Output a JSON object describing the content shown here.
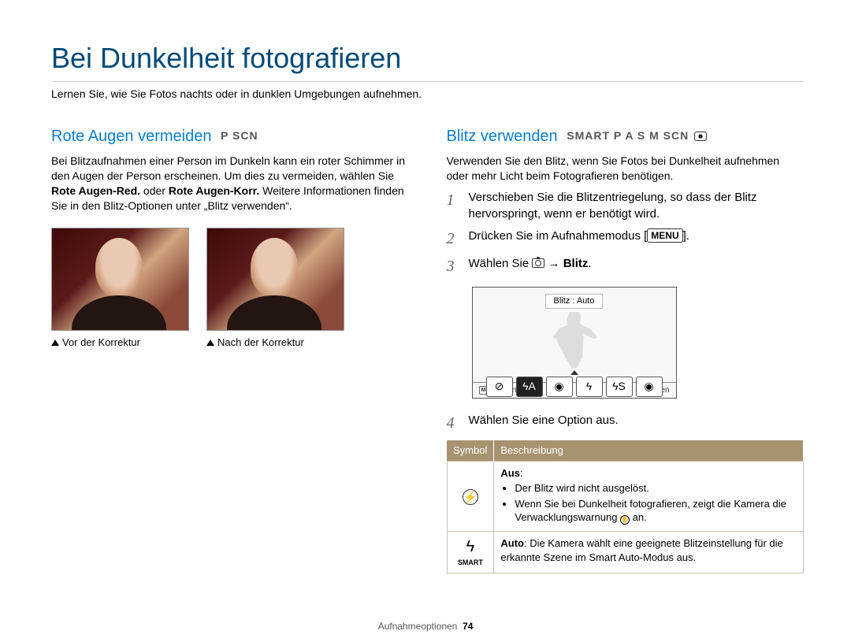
{
  "page": {
    "title": "Bei Dunkelheit fotografieren",
    "intro": "Lernen Sie, wie Sie Fotos nachts oder in dunklen Umgebungen aufnehmen.",
    "footer_section": "Aufnahmeoptionen",
    "footer_page": "74"
  },
  "left": {
    "heading": "Rote Augen vermeiden",
    "mode_icons": "P SCN",
    "body1": "Bei Blitzaufnahmen einer Person im Dunkeln kann ein roter Schimmer in den Augen der Person erscheinen. Um dies zu vermeiden, wählen Sie ",
    "bold1": "Rote Augen-Red.",
    "body1b": " oder ",
    "bold2": "Rote Augen-Korr.",
    "body1c": " Weitere Informationen finden Sie in den Blitz-Optionen unter „Blitz verwenden“.",
    "caption_before": "Vor der Korrektur",
    "caption_after": "Nach der Korrektur"
  },
  "right": {
    "heading": "Blitz verwenden",
    "mode_icons": "SMART P A S M SCN",
    "body1": "Verwenden Sie den Blitz, wenn Sie Fotos bei Dunkelheit aufnehmen oder mehr Licht beim Fotografieren benötigen.",
    "steps": {
      "s1": "Verschieben Sie die Blitzentriegelung, so dass der Blitz hervorspringt, wenn er benötigt wird.",
      "s2a": "Drücken Sie im Aufnahmemodus [",
      "s2b": "MENU",
      "s2c": "].",
      "s3a": "Wählen Sie ",
      "s3_arrow": " → ",
      "s3_bold": "Blitz",
      "s3c": ".",
      "s4": "Wählen Sie eine Option aus."
    },
    "screen": {
      "title": "Blitz : Auto",
      "back": "Zurück",
      "set": "Einstellen",
      "menu_label": "MENU"
    },
    "table": {
      "h1": "Symbol",
      "h2": "Beschreibung",
      "row1": {
        "title": "Aus",
        "li1": "Der Blitz wird nicht ausgelöst.",
        "li2a": "Wenn Sie bei Dunkelheit fotografieren, zeigt die Kamera die Verwacklungswarnung ",
        "li2b": " an."
      },
      "row2": {
        "bold": "Auto",
        "text": ": Die Kamera wählt eine geeignete Blitzeinstellung für die erkannte Szene im Smart Auto-Modus aus."
      }
    }
  }
}
